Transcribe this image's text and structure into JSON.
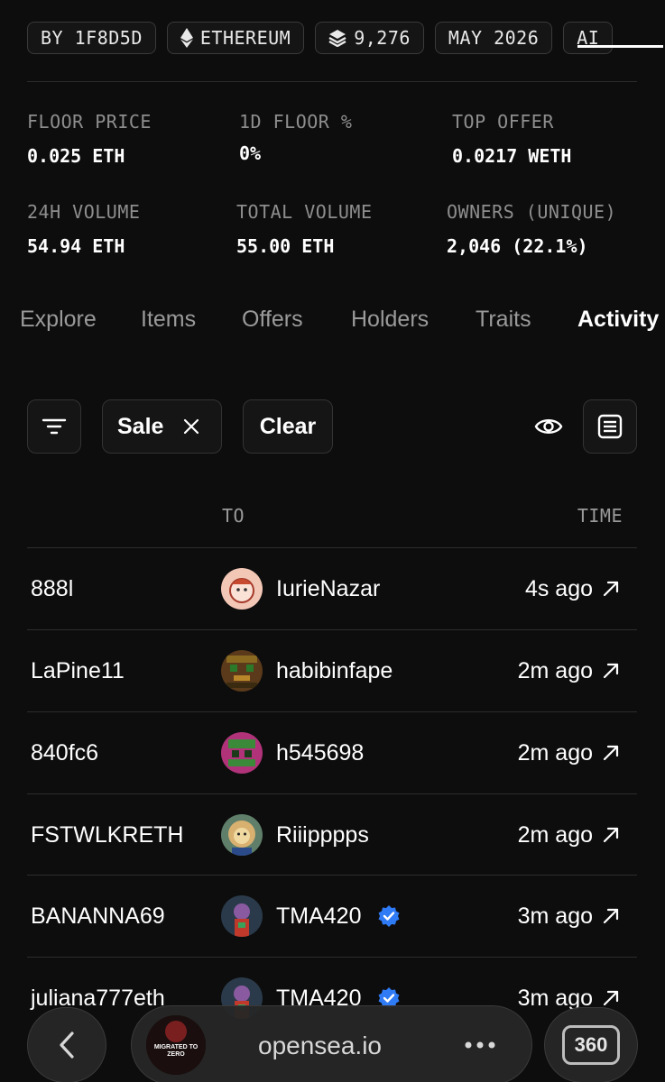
{
  "chips": [
    {
      "label": "BY 1F8D5D",
      "icon": "none"
    },
    {
      "label": "ETHEREUM",
      "icon": "ethereum-icon"
    },
    {
      "label": "9,276",
      "icon": "layers-icon"
    },
    {
      "label": "MAY 2026",
      "icon": "none"
    },
    {
      "label": "AI",
      "icon": "none"
    }
  ],
  "stats": {
    "floor_price": {
      "label": "FLOOR PRICE",
      "value": "0.025 ETH"
    },
    "floor_change": {
      "label": "1D FLOOR %",
      "value": "0%"
    },
    "top_offer": {
      "label": "TOP OFFER",
      "value": "0.0217 WETH"
    },
    "volume_24h": {
      "label": "24H VOLUME",
      "value": "54.94 ETH"
    },
    "total_volume": {
      "label": "TOTAL VOLUME",
      "value": "55.00 ETH"
    },
    "owners": {
      "label": "OWNERS (UNIQUE)",
      "value": "2,046 (22.1%)"
    }
  },
  "tabs": [
    "Explore",
    "Items",
    "Offers",
    "Holders",
    "Traits",
    "Activity"
  ],
  "active_tab": "Activity",
  "filters": {
    "filter_icon": "filter-icon",
    "sale_label": "Sale",
    "clear_label": "Clear"
  },
  "table": {
    "headers": {
      "to": "TO",
      "time": "TIME"
    },
    "rows": [
      {
        "from": "888l",
        "to": "IurieNazar",
        "verified": false,
        "time": "4s ago",
        "avatar": "lion-cartoon"
      },
      {
        "from": "LaPine11",
        "to": "habibinfape",
        "verified": false,
        "time": "2m ago",
        "avatar": "pixel-olive"
      },
      {
        "from": "840fc6",
        "to": "h545698",
        "verified": false,
        "time": "2m ago",
        "avatar": "pixel-green-magenta"
      },
      {
        "from": "FSTWLKRETH",
        "to": "Riiipppps",
        "verified": false,
        "time": "2m ago",
        "avatar": "lion-illustration"
      },
      {
        "from": "BANANNA69",
        "to": "TMA420",
        "verified": true,
        "time": "3m ago",
        "avatar": "ape-purple"
      },
      {
        "from": "juliana777eth",
        "to": "TMA420",
        "verified": true,
        "time": "3m ago",
        "avatar": "ape-purple"
      }
    ]
  },
  "browser": {
    "domain": "opensea.io",
    "thumb_text": "MIGRATED TO ZERO",
    "badge": "360"
  },
  "colors": {
    "background": "#0d0d0d",
    "muted_text": "#8e8e8e",
    "verified_blue": "#2f7bf6"
  }
}
